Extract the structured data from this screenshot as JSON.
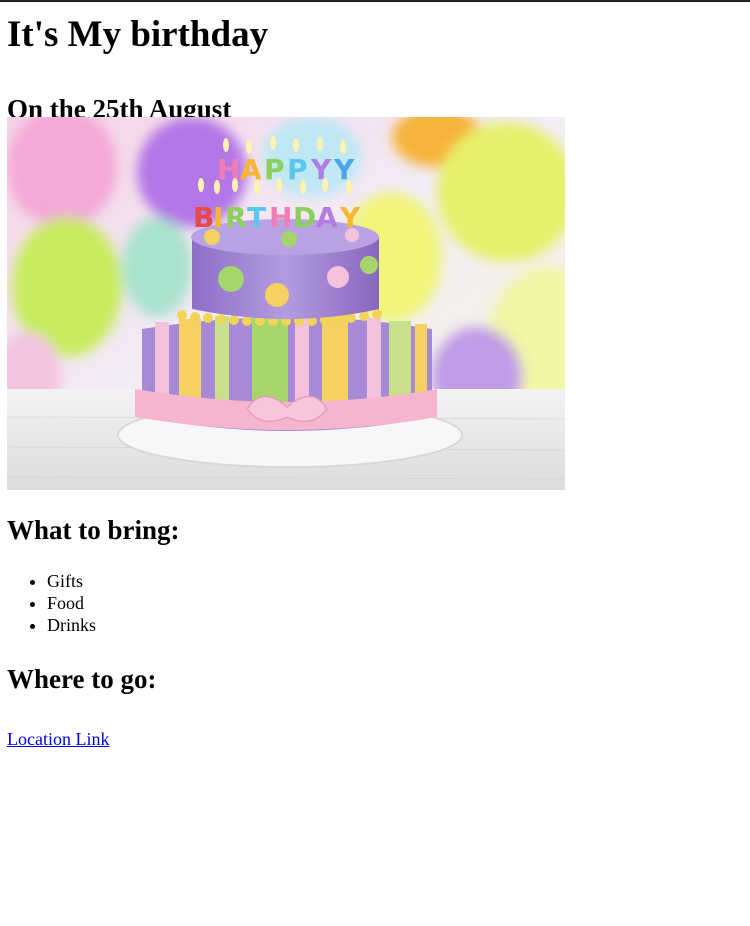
{
  "header": {
    "title": "It's My birthday",
    "date": "On the 25th August"
  },
  "image": {
    "alt": "Happy Birthday cake"
  },
  "bring": {
    "title": "What to bring:",
    "items": [
      "Gifts",
      "Food",
      "Drinks"
    ]
  },
  "where": {
    "title": "Where to go:",
    "link_label": "Location Link"
  }
}
